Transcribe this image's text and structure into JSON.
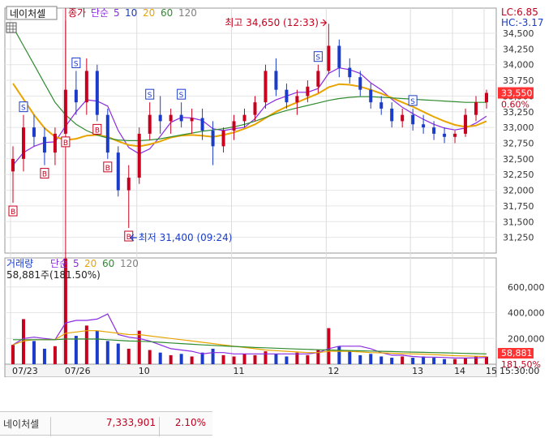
{
  "header": {
    "stock_name": "네이처셀",
    "grid_icon": "grid-icon",
    "price_legend_label": "종가",
    "price_ma_label": "단순",
    "price_ma_periods": [
      "5",
      "10",
      "20",
      "60",
      "120"
    ],
    "volume_legend_label": "거래량",
    "volume_ma_label": "단순",
    "volume_ma_periods": [
      "5",
      "20",
      "60",
      "120"
    ],
    "lc_label": "LC:6.85",
    "hc_label": "HC:-3.17",
    "volume_readout": "58,881주(181.50%)"
  },
  "annotations": {
    "high_label": "최고 34,650 (12:33)",
    "low_label": "최저 31,400 (09:24)"
  },
  "chart_data": {
    "type": "candlestick",
    "title": "",
    "price_panel": {
      "ylim": [
        31000,
        34900
      ],
      "y_ticks": [
        "34,500",
        "34,250",
        "34,000",
        "33,750",
        "33,500",
        "33,250",
        "33,000",
        "32,750",
        "32,500",
        "32,250",
        "32,000",
        "31,750",
        "31,500",
        "31,250"
      ],
      "current_price": "33,550",
      "current_change": "0.60%",
      "high": 34650,
      "low": 31400,
      "candles": [
        {
          "o": 32300,
          "h": 32700,
          "l": 31800,
          "c": 32500
        },
        {
          "o": 32500,
          "h": 33200,
          "l": 32300,
          "c": 33000
        },
        {
          "o": 33000,
          "h": 33200,
          "l": 32700,
          "c": 32850
        },
        {
          "o": 32850,
          "h": 33000,
          "l": 32400,
          "c": 32600
        },
        {
          "o": 32600,
          "h": 33000,
          "l": 32400,
          "c": 32900
        },
        {
          "o": 32900,
          "h": 34700,
          "l": 32900,
          "c": 33600
        },
        {
          "o": 33600,
          "h": 33900,
          "l": 33200,
          "c": 33400
        },
        {
          "o": 33400,
          "h": 34100,
          "l": 33200,
          "c": 33900
        },
        {
          "o": 33900,
          "h": 34000,
          "l": 33100,
          "c": 33200
        },
        {
          "o": 33200,
          "h": 33300,
          "l": 32500,
          "c": 32600
        },
        {
          "o": 32600,
          "h": 32700,
          "l": 31900,
          "c": 32000
        },
        {
          "o": 32000,
          "h": 32400,
          "l": 31400,
          "c": 32200
        },
        {
          "o": 32200,
          "h": 33000,
          "l": 32100,
          "c": 32900
        },
        {
          "o": 32900,
          "h": 33400,
          "l": 32800,
          "c": 33200
        },
        {
          "o": 33200,
          "h": 33500,
          "l": 32900,
          "c": 33100
        },
        {
          "o": 33100,
          "h": 33300,
          "l": 32900,
          "c": 33200
        },
        {
          "o": 33200,
          "h": 33400,
          "l": 33000,
          "c": 33100
        },
        {
          "o": 33100,
          "h": 33300,
          "l": 32900,
          "c": 33150
        },
        {
          "o": 33150,
          "h": 33300,
          "l": 32800,
          "c": 32950
        },
        {
          "o": 32950,
          "h": 33100,
          "l": 32400,
          "c": 32700
        },
        {
          "o": 32700,
          "h": 33000,
          "l": 32600,
          "c": 32950
        },
        {
          "o": 32950,
          "h": 33200,
          "l": 32800,
          "c": 33100
        },
        {
          "o": 33100,
          "h": 33300,
          "l": 33000,
          "c": 33200
        },
        {
          "o": 33200,
          "h": 33500,
          "l": 33100,
          "c": 33400
        },
        {
          "o": 33400,
          "h": 34000,
          "l": 33300,
          "c": 33900
        },
        {
          "o": 33900,
          "h": 34100,
          "l": 33500,
          "c": 33600
        },
        {
          "o": 33600,
          "h": 33700,
          "l": 33300,
          "c": 33400
        },
        {
          "o": 33400,
          "h": 33600,
          "l": 33200,
          "c": 33500
        },
        {
          "o": 33500,
          "h": 33750,
          "l": 33400,
          "c": 33650
        },
        {
          "o": 33650,
          "h": 34000,
          "l": 33550,
          "c": 33900
        },
        {
          "o": 33900,
          "h": 34650,
          "l": 33850,
          "c": 34300
        },
        {
          "o": 34300,
          "h": 34400,
          "l": 33800,
          "c": 33950
        },
        {
          "o": 33950,
          "h": 34100,
          "l": 33700,
          "c": 33800
        },
        {
          "o": 33800,
          "h": 33900,
          "l": 33500,
          "c": 33600
        },
        {
          "o": 33600,
          "h": 33700,
          "l": 33300,
          "c": 33400
        },
        {
          "o": 33400,
          "h": 33500,
          "l": 33200,
          "c": 33300
        },
        {
          "o": 33300,
          "h": 33400,
          "l": 33000,
          "c": 33100
        },
        {
          "o": 33100,
          "h": 33300,
          "l": 33000,
          "c": 33200
        },
        {
          "o": 33200,
          "h": 33300,
          "l": 32950,
          "c": 33050
        },
        {
          "o": 33050,
          "h": 33200,
          "l": 32900,
          "c": 33000
        },
        {
          "o": 33000,
          "h": 33100,
          "l": 32800,
          "c": 32900
        },
        {
          "o": 32900,
          "h": 33000,
          "l": 32750,
          "c": 32850
        },
        {
          "o": 32850,
          "h": 32950,
          "l": 32750,
          "c": 32900
        },
        {
          "o": 32900,
          "h": 33300,
          "l": 32850,
          "c": 33200
        },
        {
          "o": 33200,
          "h": 33500,
          "l": 33100,
          "c": 33400
        },
        {
          "o": 33400,
          "h": 33600,
          "l": 33300,
          "c": 33550
        }
      ],
      "ma_lines": [
        {
          "period": "5",
          "color": "#8a2be2",
          "values": [
            32400,
            32600,
            32700,
            32760,
            32770,
            33020,
            33250,
            33440,
            33420,
            33340,
            32950,
            32680,
            32580,
            32660,
            32860,
            33080,
            33160,
            33150,
            33110,
            32980,
            32950,
            32980,
            33000,
            33140,
            33350,
            33440,
            33500,
            33560,
            33560,
            33620,
            33860,
            33950,
            33920,
            33860,
            33710,
            33600,
            33450,
            33320,
            33220,
            33130,
            33050,
            32990,
            32960,
            32990,
            33070,
            33180
          ]
        },
        {
          "period": "20",
          "color": "#e8a400",
          "values": [
            33700,
            33450,
            33200,
            32990,
            32850,
            32800,
            32820,
            32870,
            32880,
            32850,
            32780,
            32720,
            32700,
            32730,
            32780,
            32840,
            32870,
            32880,
            32870,
            32850,
            32880,
            32920,
            32980,
            33050,
            33150,
            33250,
            33330,
            33400,
            33470,
            33540,
            33640,
            33690,
            33680,
            33650,
            33600,
            33540,
            33470,
            33400,
            33330,
            33250,
            33170,
            33100,
            33040,
            33010,
            33030,
            33100
          ]
        },
        {
          "period": "60",
          "color": "#2e8b2e",
          "values": [
            34600,
            34300,
            34000,
            33700,
            33400,
            33200,
            33050,
            32950,
            32880,
            32830,
            32800,
            32790,
            32790,
            32800,
            32820,
            32850,
            32880,
            32910,
            32940,
            32960,
            32980,
            33010,
            33050,
            33100,
            33160,
            33220,
            33270,
            33310,
            33350,
            33390,
            33430,
            33460,
            33480,
            33490,
            33490,
            33480,
            33470,
            33460,
            33450,
            33440,
            33430,
            33420,
            33410,
            33400,
            33400,
            33400
          ]
        }
      ]
    },
    "volume_panel": {
      "ylim": [
        0,
        800000
      ],
      "y_ticks": [
        "600,000",
        "400,000",
        "200,000"
      ],
      "current_volume": "58,881",
      "current_ratio": "181.50%",
      "volumes": [
        150000,
        350000,
        180000,
        120000,
        140000,
        820000,
        220000,
        300000,
        260000,
        180000,
        160000,
        120000,
        260000,
        110000,
        90000,
        70000,
        80000,
        60000,
        90000,
        120000,
        70000,
        60000,
        80000,
        70000,
        100000,
        80000,
        60000,
        90000,
        70000,
        110000,
        280000,
        140000,
        100000,
        70000,
        80000,
        60000,
        50000,
        60000,
        50000,
        60000,
        50000,
        40000,
        40000,
        50000,
        60000,
        58881
      ],
      "ma_lines": [
        {
          "period": "5",
          "color": "#8a2be2",
          "values": [
            150000,
            200000,
            210000,
            200000,
            190000,
            320000,
            340000,
            340000,
            350000,
            390000,
            230000,
            210000,
            200000,
            180000,
            150000,
            120000,
            110000,
            100000,
            80000,
            90000,
            90000,
            80000,
            80000,
            80000,
            80000,
            80000,
            80000,
            80000,
            80000,
            90000,
            120000,
            140000,
            140000,
            140000,
            120000,
            90000,
            70000,
            70000,
            60000,
            55000,
            55000,
            52000,
            48000,
            48000,
            50000,
            52000
          ]
        },
        {
          "period": "20",
          "color": "#e8a400",
          "values": [
            150000,
            180000,
            190000,
            190000,
            190000,
            240000,
            250000,
            260000,
            260000,
            250000,
            240000,
            230000,
            230000,
            220000,
            210000,
            200000,
            190000,
            180000,
            170000,
            160000,
            150000,
            140000,
            130000,
            120000,
            110000,
            105000,
            100000,
            95000,
            90000,
            90000,
            100000,
            100000,
            100000,
            95000,
            90000,
            88000,
            85000,
            82000,
            80000,
            78000,
            75000,
            70000,
            66000,
            64000,
            62000,
            60000
          ]
        },
        {
          "period": "60",
          "color": "#2e8b2e",
          "values": [
            190000,
            190000,
            190000,
            190000,
            190000,
            195000,
            195000,
            195000,
            195000,
            190000,
            185000,
            180000,
            178000,
            175000,
            170000,
            165000,
            160000,
            155000,
            150000,
            146000,
            142000,
            138000,
            134000,
            130000,
            127000,
            124000,
            121000,
            118000,
            115000,
            112000,
            110000,
            108000,
            106000,
            104000,
            102000,
            100000,
            98000,
            96000,
            94000,
            92000,
            90000,
            88000,
            86000,
            84000,
            82000,
            80000
          ]
        }
      ]
    },
    "x_tick_labels": [
      "07/23",
      "07/26",
      "10",
      "11",
      "12",
      "13",
      "14",
      "15",
      "15:30:00"
    ]
  },
  "summary": {
    "name": "네이처셀",
    "value": "7,333,901",
    "pct": "2.10%"
  }
}
